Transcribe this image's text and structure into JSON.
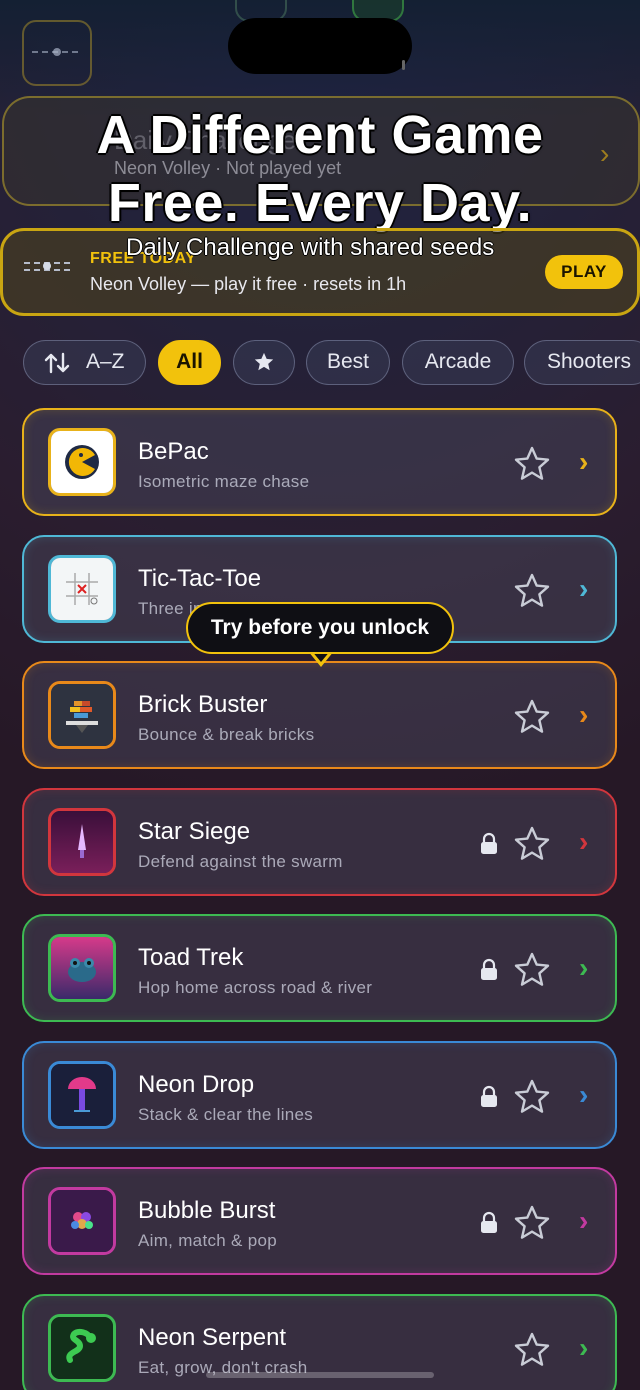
{
  "headline": {
    "line1": "A Different Game",
    "line2": "Free. Every Day."
  },
  "daily_card": {
    "title": "Daily Challenge",
    "subtitle": "Neon Volley · Not played yet"
  },
  "free_today": {
    "badge": "FREE TODAY",
    "overlay": "Daily Challenge with shared seeds",
    "subtitle": "Neon Volley — play it free · resets in 1h",
    "play_label": "PLAY"
  },
  "filters": {
    "sort_label": "A–Z",
    "all_label": "All",
    "best_label": "Best",
    "arcade_label": "Arcade",
    "shooters_label": "Shooters"
  },
  "tooltip": "Try before you unlock",
  "games": [
    {
      "title": "BePac",
      "subtitle": "Isometric maze chase",
      "color": "#e8b21a",
      "locked": false,
      "icon": "pacman-icon"
    },
    {
      "title": "Tic-Tac-Toe",
      "subtitle": "Three in a row",
      "color": "#4fb8d6",
      "locked": false,
      "icon": "tictactoe-icon"
    },
    {
      "title": "Brick Buster",
      "subtitle": "Bounce & break bricks",
      "color": "#e8891a",
      "locked": false,
      "icon": "brick-icon"
    },
    {
      "title": "Star Siege",
      "subtitle": "Defend against the swarm",
      "color": "#d2363d",
      "locked": true,
      "icon": "rocket-icon"
    },
    {
      "title": "Toad Trek",
      "subtitle": "Hop home across road & river",
      "color": "#3dba52",
      "locked": true,
      "icon": "frog-icon"
    },
    {
      "title": "Neon Drop",
      "subtitle": "Stack & clear the lines",
      "color": "#3a8ad6",
      "locked": true,
      "icon": "drop-icon"
    },
    {
      "title": "Bubble Burst",
      "subtitle": "Aim, match & pop",
      "color": "#c23aa0",
      "locked": true,
      "icon": "bubble-icon"
    },
    {
      "title": "Neon Serpent",
      "subtitle": "Eat, grow, don't crash",
      "color": "#3dba52",
      "locked": false,
      "icon": "snake-icon"
    }
  ]
}
